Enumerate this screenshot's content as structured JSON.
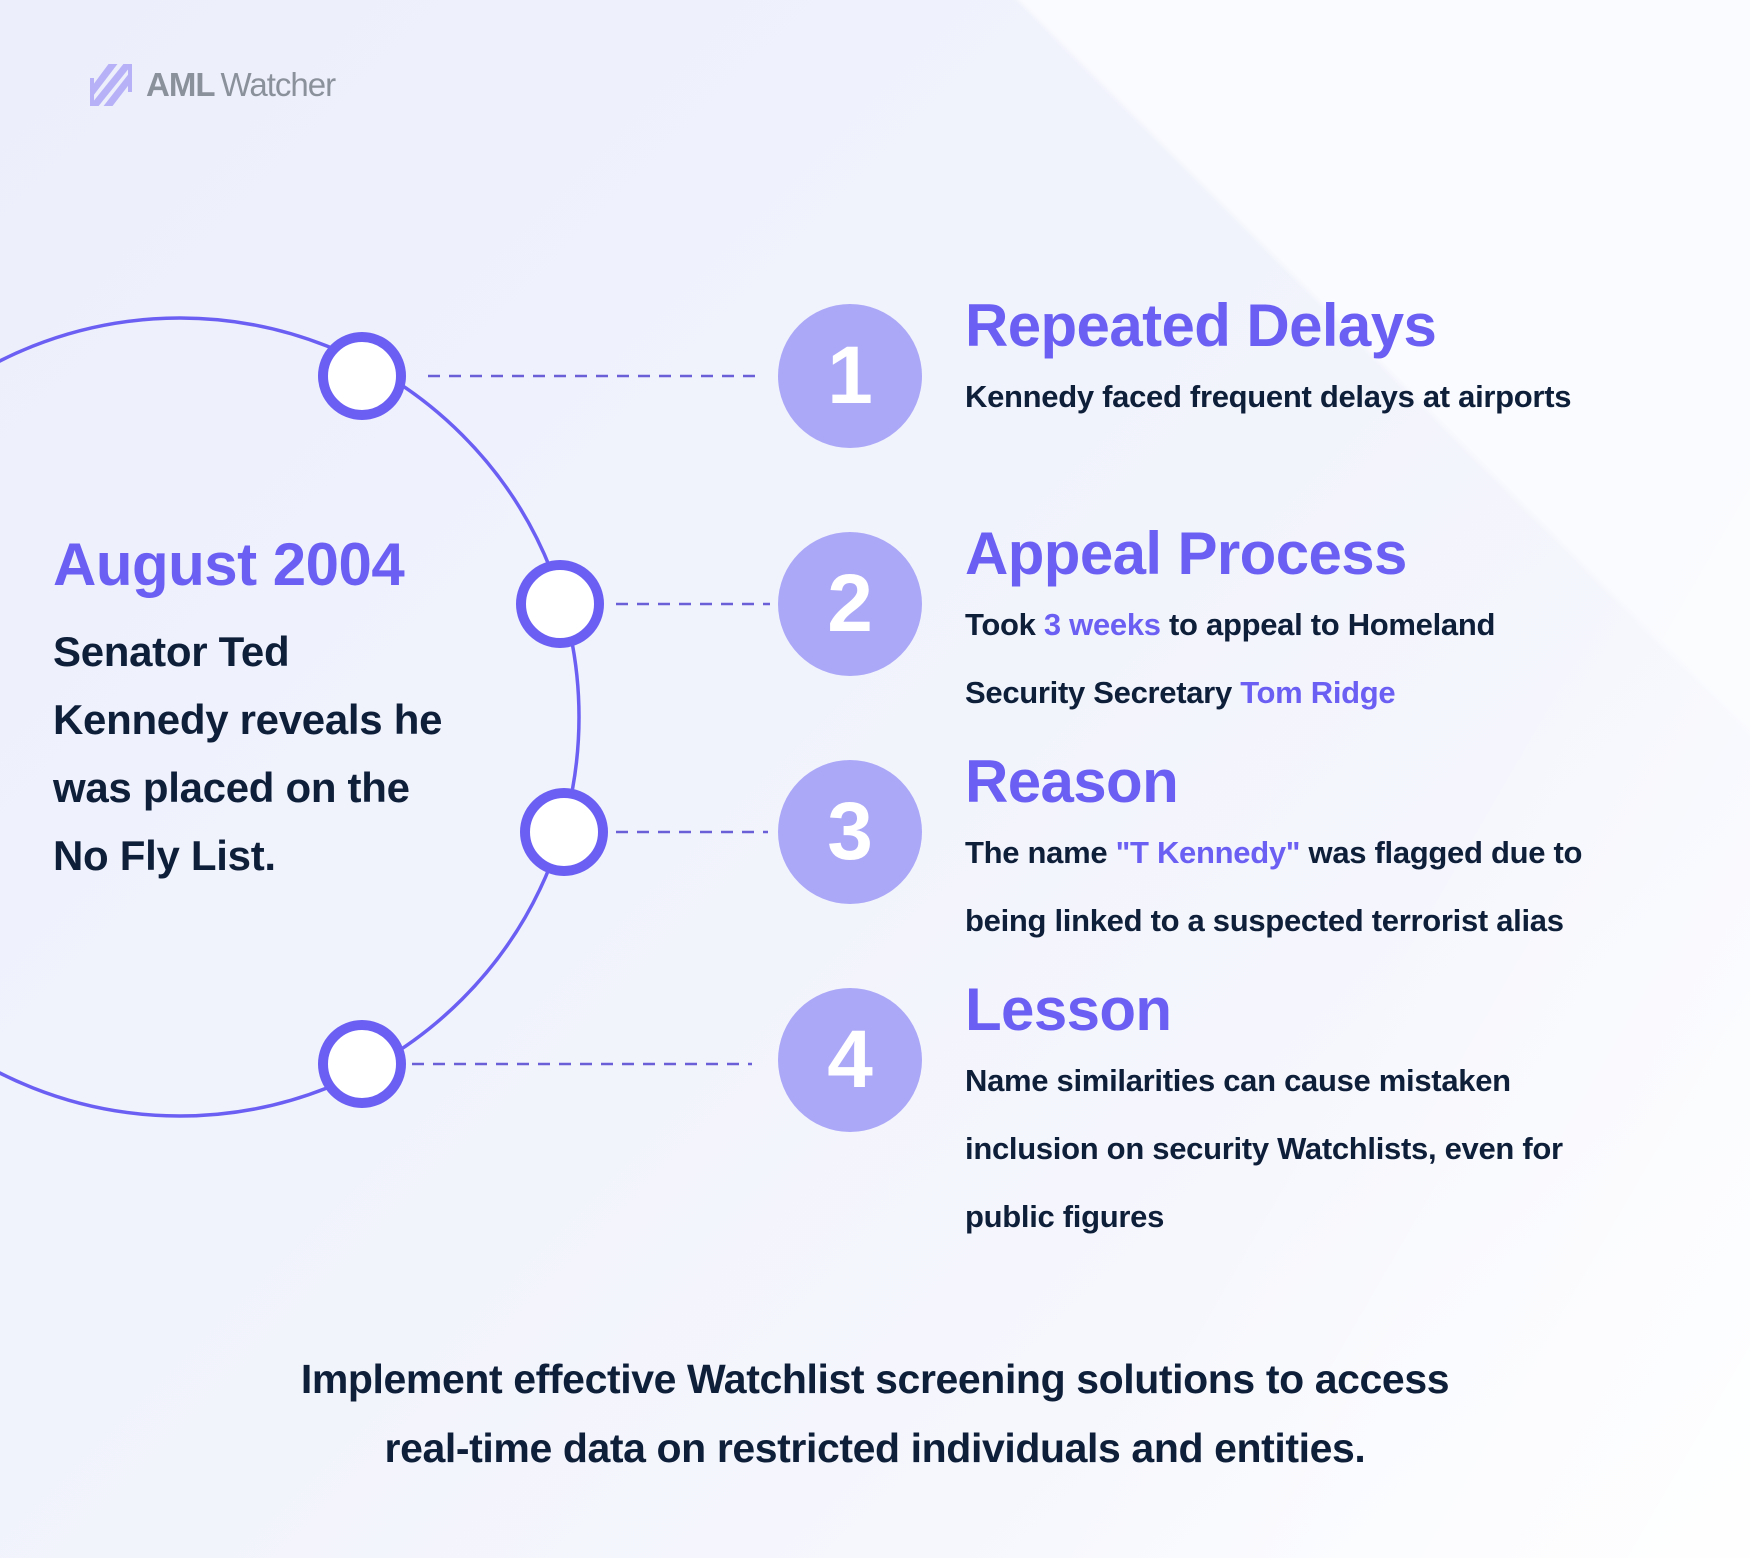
{
  "brand": {
    "name_bold": "AML",
    "name_light": "Watcher",
    "icon": "striped-logo-icon",
    "icon_color": "#b7b2f7",
    "text_color": "#8b919b"
  },
  "colors": {
    "accent": "#6b5ff3",
    "badge": "#aca8f8",
    "dark_text": "#0e1f3a",
    "background": "#eef0fb"
  },
  "intro": {
    "date": "August 2004",
    "body_lines": [
      "Senator Ted",
      "Kennedy reveals he",
      "was placed on the",
      "No Fly List."
    ]
  },
  "timeline": [
    {
      "number": "1",
      "title": "Repeated Delays",
      "lines": [
        [
          {
            "text": "Kennedy faced frequent delays at airports",
            "highlight": false
          }
        ]
      ]
    },
    {
      "number": "2",
      "title": "Appeal Process",
      "lines": [
        [
          {
            "text": "Took ",
            "highlight": false
          },
          {
            "text": "3 weeks",
            "highlight": true
          },
          {
            "text": " to appeal to Homeland",
            "highlight": false
          }
        ],
        [
          {
            "text": "Security Secretary ",
            "highlight": false
          },
          {
            "text": "Tom Ridge",
            "highlight": true
          }
        ]
      ]
    },
    {
      "number": "3",
      "title": "Reason",
      "lines": [
        [
          {
            "text": "The name ",
            "highlight": false
          },
          {
            "text": "\"T Kennedy\"",
            "highlight": true
          },
          {
            "text": " was flagged due to",
            "highlight": false
          }
        ],
        [
          {
            "text": "being linked to a suspected terrorist alias",
            "highlight": false
          }
        ]
      ]
    },
    {
      "number": "4",
      "title": "Lesson",
      "lines": [
        [
          {
            "text": "Name similarities can cause mistaken",
            "highlight": false
          }
        ],
        [
          {
            "text": "inclusion on security Watchlists, even for",
            "highlight": false
          }
        ],
        [
          {
            "text": "public figures",
            "highlight": false
          }
        ]
      ]
    }
  ],
  "footer": {
    "lines": [
      "Implement effective Watchlist screening solutions to access",
      "real-time data on restricted individuals and entities."
    ]
  }
}
